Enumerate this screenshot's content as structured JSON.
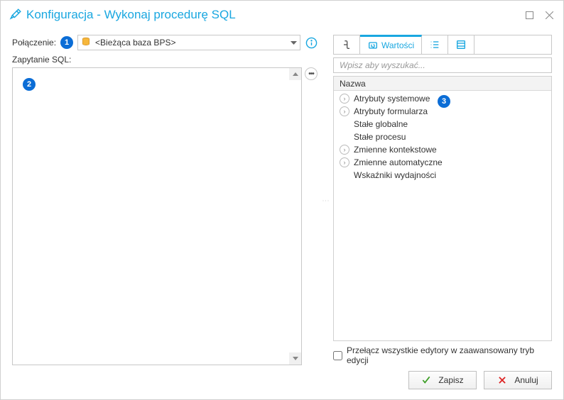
{
  "window": {
    "title": "Konfiguracja - Wykonaj procedurę SQL"
  },
  "left": {
    "connection_label": "Połączenie:",
    "connection_value": "<Bieżąca baza BPS>",
    "sql_label": "Zapytanie SQL:"
  },
  "tabs": {
    "active_label": "Wartości"
  },
  "search": {
    "placeholder": "Wpisz aby wyszukać..."
  },
  "tree": {
    "header": "Nazwa",
    "items": [
      {
        "label": "Atrybuty systemowe",
        "expandable": true
      },
      {
        "label": "Atrybuty formularza",
        "expandable": true
      },
      {
        "label": "Stałe globalne",
        "expandable": false
      },
      {
        "label": "Stałe procesu",
        "expandable": false
      },
      {
        "label": "Zmienne kontekstowe",
        "expandable": true
      },
      {
        "label": "Zmienne automatyczne",
        "expandable": true
      },
      {
        "label": "Wskaźniki wydajności",
        "expandable": false
      }
    ]
  },
  "checkbox": {
    "label": "Przełącz wszystkie edytory w zaawansowany tryb edycji"
  },
  "buttons": {
    "save": "Zapisz",
    "cancel": "Anuluj"
  },
  "badges": {
    "b1": "1",
    "b2": "2",
    "b3": "3"
  }
}
